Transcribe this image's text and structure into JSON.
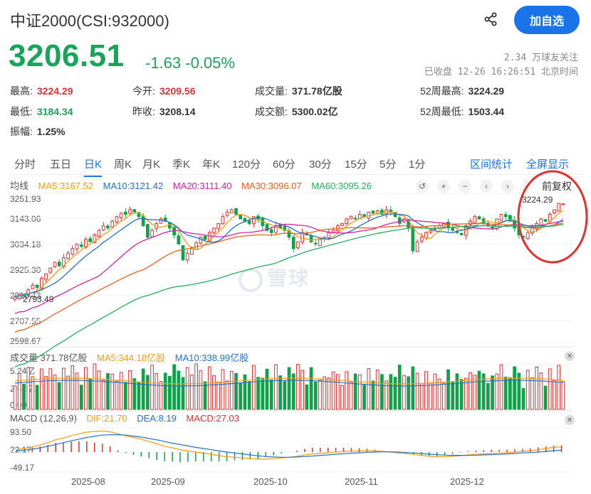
{
  "header": {
    "title": "中证2000(CSI:932000)",
    "follow_label": "加自选",
    "price": "3206.51",
    "change": "-1.63 -0.05%",
    "followers": "2.34 万球友关注",
    "status": "已收盘 12-26 16:26:51 北京时间"
  },
  "stats": {
    "high_k": "最高:",
    "high_v": "3224.29",
    "open_k": "今开:",
    "open_v": "3209.56",
    "volume_k": "成交量:",
    "volume_v": "371.78亿股",
    "w52high_k": "52周最高:",
    "w52high_v": "3224.29",
    "low_k": "最低:",
    "low_v": "3184.34",
    "prevclose_k": "昨收:",
    "prevclose_v": "3208.14",
    "amount_k": "成交额:",
    "amount_v": "5300.02亿",
    "w52low_k": "52周最低:",
    "w52low_v": "1503.44",
    "amplitude_k": "振幅:",
    "amplitude_v": "1.25%"
  },
  "tabs": [
    "分时",
    "五日",
    "日K",
    "周K",
    "月K",
    "季K",
    "年K",
    "120分",
    "60分",
    "30分",
    "15分",
    "5分",
    "1分"
  ],
  "active_tab": "日K",
  "tab_links": {
    "range_stats": "区间统计",
    "fullscreen": "全屏显示"
  },
  "ma_legend": {
    "label": "均线",
    "ma5": "MA5:3167.52",
    "ma10": "MA10:3121.42",
    "ma20": "MA20:3111.40",
    "ma30": "MA30:3096.07",
    "ma60": "MA60:3095.26"
  },
  "fuquan": "前复权",
  "price_axis": [
    "3251.93",
    "3143.06",
    "3034.18",
    "2925.30",
    "2816.43",
    "2707.55",
    "2598.67"
  ],
  "price_markers": {
    "high": "3224.29",
    "low": "2793.49"
  },
  "volume_legend": {
    "label": "成交量 371.78亿股",
    "ma5": "MA5:344.18亿股",
    "ma10": "MA10:338.99亿股"
  },
  "volume_axis": [
    "5.24亿",
    "2.62亿",
    "0.00"
  ],
  "macd_legend": {
    "label": "MACD (12,26,9)",
    "dif": "DIF:21.70",
    "dea": "DEA:8.19",
    "macd": "MACD:27.03"
  },
  "macd_axis": [
    "93.50",
    "22.17",
    "-49.17"
  ],
  "dates": [
    "2025-08",
    "2025-09",
    "2025-10",
    "2025-11",
    "2025-12"
  ],
  "watermark": "雪球",
  "colors": {
    "up": "#e03131",
    "down": "#12a14b",
    "ma5": "#f39c12",
    "ma10": "#2471c8",
    "ma20": "#d6249f",
    "ma30": "#f06020",
    "ma60": "#27ae60",
    "accent": "#1a73e8",
    "highlight_circle": "#e03131"
  },
  "chart_data": {
    "type": "candlestick",
    "ylim": [
      2598.67,
      3251.93
    ],
    "close": [
      2798,
      2810,
      2805,
      2830,
      2850,
      2840,
      2880,
      2900,
      2925,
      2950,
      2935,
      2970,
      2990,
      3010,
      3030,
      3020,
      3050,
      3040,
      3070,
      3090,
      3110,
      3100,
      3130,
      3150,
      3165,
      3160,
      3180,
      3170,
      3150,
      3110,
      3060,
      3090,
      3120,
      3140,
      3130,
      3100,
      3070,
      3030,
      2960,
      2990,
      3010,
      3035,
      3060,
      3050,
      3080,
      3100,
      3120,
      3150,
      3170,
      3180,
      3160,
      3140,
      3130,
      3120,
      3150,
      3140,
      3110,
      3090,
      3080,
      3110,
      3100,
      3090,
      3060,
      3010,
      3040,
      3080,
      3070,
      3040,
      3030,
      3050,
      3060,
      3080,
      3090,
      3110,
      3120,
      3140,
      3150,
      3140,
      3160,
      3150,
      3170,
      3165,
      3175,
      3160,
      3180,
      3170,
      3150,
      3120,
      3140,
      3100,
      3000,
      3040,
      3060,
      3080,
      3090,
      3100,
      3110,
      3120,
      3100,
      3090,
      3080,
      3070,
      3110,
      3130,
      3150,
      3140,
      3120,
      3110,
      3100,
      3140,
      3160,
      3150,
      3130,
      3100,
      3070,
      3060,
      3080,
      3100,
      3120,
      3140,
      3130,
      3160,
      3180,
      3208,
      3206
    ],
    "macd_dif": [
      10,
      15,
      22,
      30,
      40,
      52,
      60,
      70,
      78,
      85,
      88,
      90,
      86,
      78,
      70,
      62,
      55,
      45,
      35,
      25,
      18,
      10,
      5,
      0,
      -5,
      -10,
      -15,
      -20,
      -22,
      -25,
      -28,
      -30,
      -30,
      -28,
      -25,
      -22,
      -18,
      -12,
      -8,
      -5,
      -3,
      0,
      2,
      4,
      5,
      6,
      5,
      3,
      0,
      -3,
      -6,
      -10,
      -14,
      -18,
      -20,
      -20,
      -18,
      -15,
      -12,
      -10,
      -8,
      -6,
      -5,
      -3,
      0,
      3,
      6,
      10,
      15,
      20,
      22
    ],
    "macd_dea": [
      5,
      8,
      12,
      18,
      25,
      32,
      40,
      48,
      55,
      62,
      68,
      72,
      74,
      74,
      72,
      68,
      64,
      58,
      52,
      45,
      38,
      32,
      26,
      20,
      15,
      10,
      5,
      0,
      -4,
      -8,
      -12,
      -16,
      -19,
      -21,
      -22,
      -22,
      -21,
      -19,
      -17,
      -14,
      -12,
      -9,
      -7,
      -5,
      -3,
      -1,
      0,
      1,
      1,
      0,
      -2,
      -4,
      -6,
      -9,
      -11,
      -13,
      -14,
      -14,
      -14,
      -13,
      -12,
      -11,
      -10,
      -8,
      -6,
      -4,
      -2,
      0,
      3,
      6,
      8
    ]
  }
}
